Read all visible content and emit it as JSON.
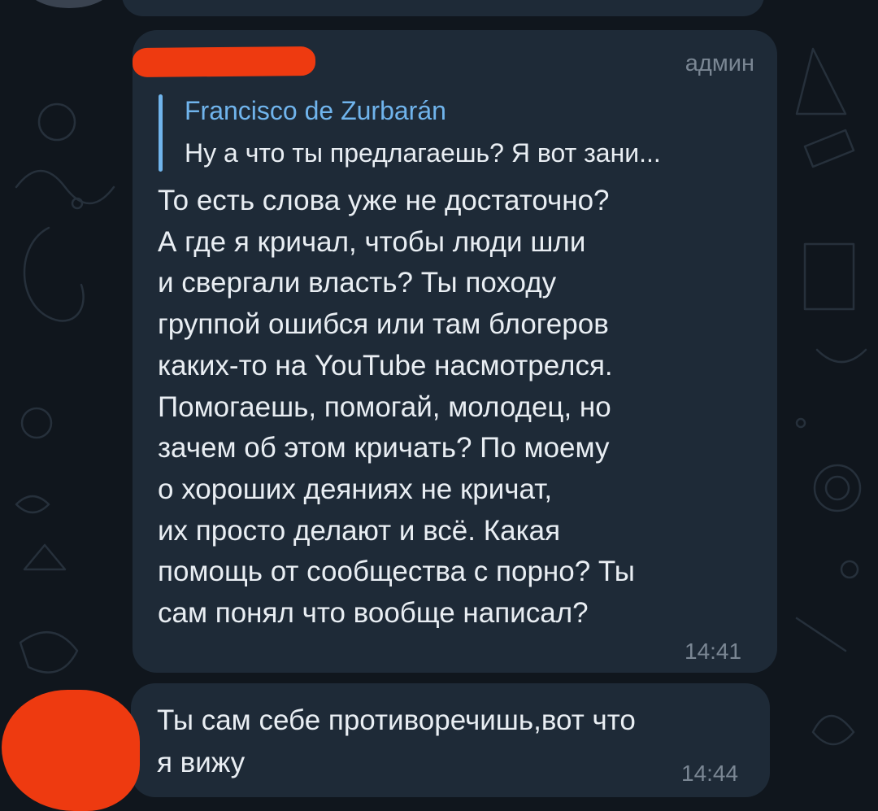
{
  "messages": [
    {
      "sender_tag": "админ",
      "reply": {
        "author": "Francisco de Zurbarán",
        "text": "Ну а что ты предлагаешь? Я вот зани..."
      },
      "lines": [
        "То есть слова уже не достаточно?",
        "А где я кричал, чтобы люди шли",
        "и свергали власть? Ты походу",
        "группой ошибся или там блогеров",
        "каких-то на YouTube насмотрелся.",
        "Помогаешь, помогай, молодец, но",
        "зачем об этом кричать? По моему",
        "о хороших деяниях не кричат,",
        "их просто делают и всё. Какая",
        "помощь от сообщества с порно? Ты",
        "сам понял что вообще написал?"
      ],
      "time": "14:41"
    },
    {
      "lines": [
        "Ты сам себе противоречишь,вот что",
        "я вижу"
      ],
      "time": "14:44"
    }
  ],
  "colors": {
    "background": "#10161d",
    "bubble": "#1e2a37",
    "reply_accent": "#70b4ec",
    "text": "#e9eef3",
    "meta": "#7a8693",
    "redaction": "#ee3a10"
  }
}
